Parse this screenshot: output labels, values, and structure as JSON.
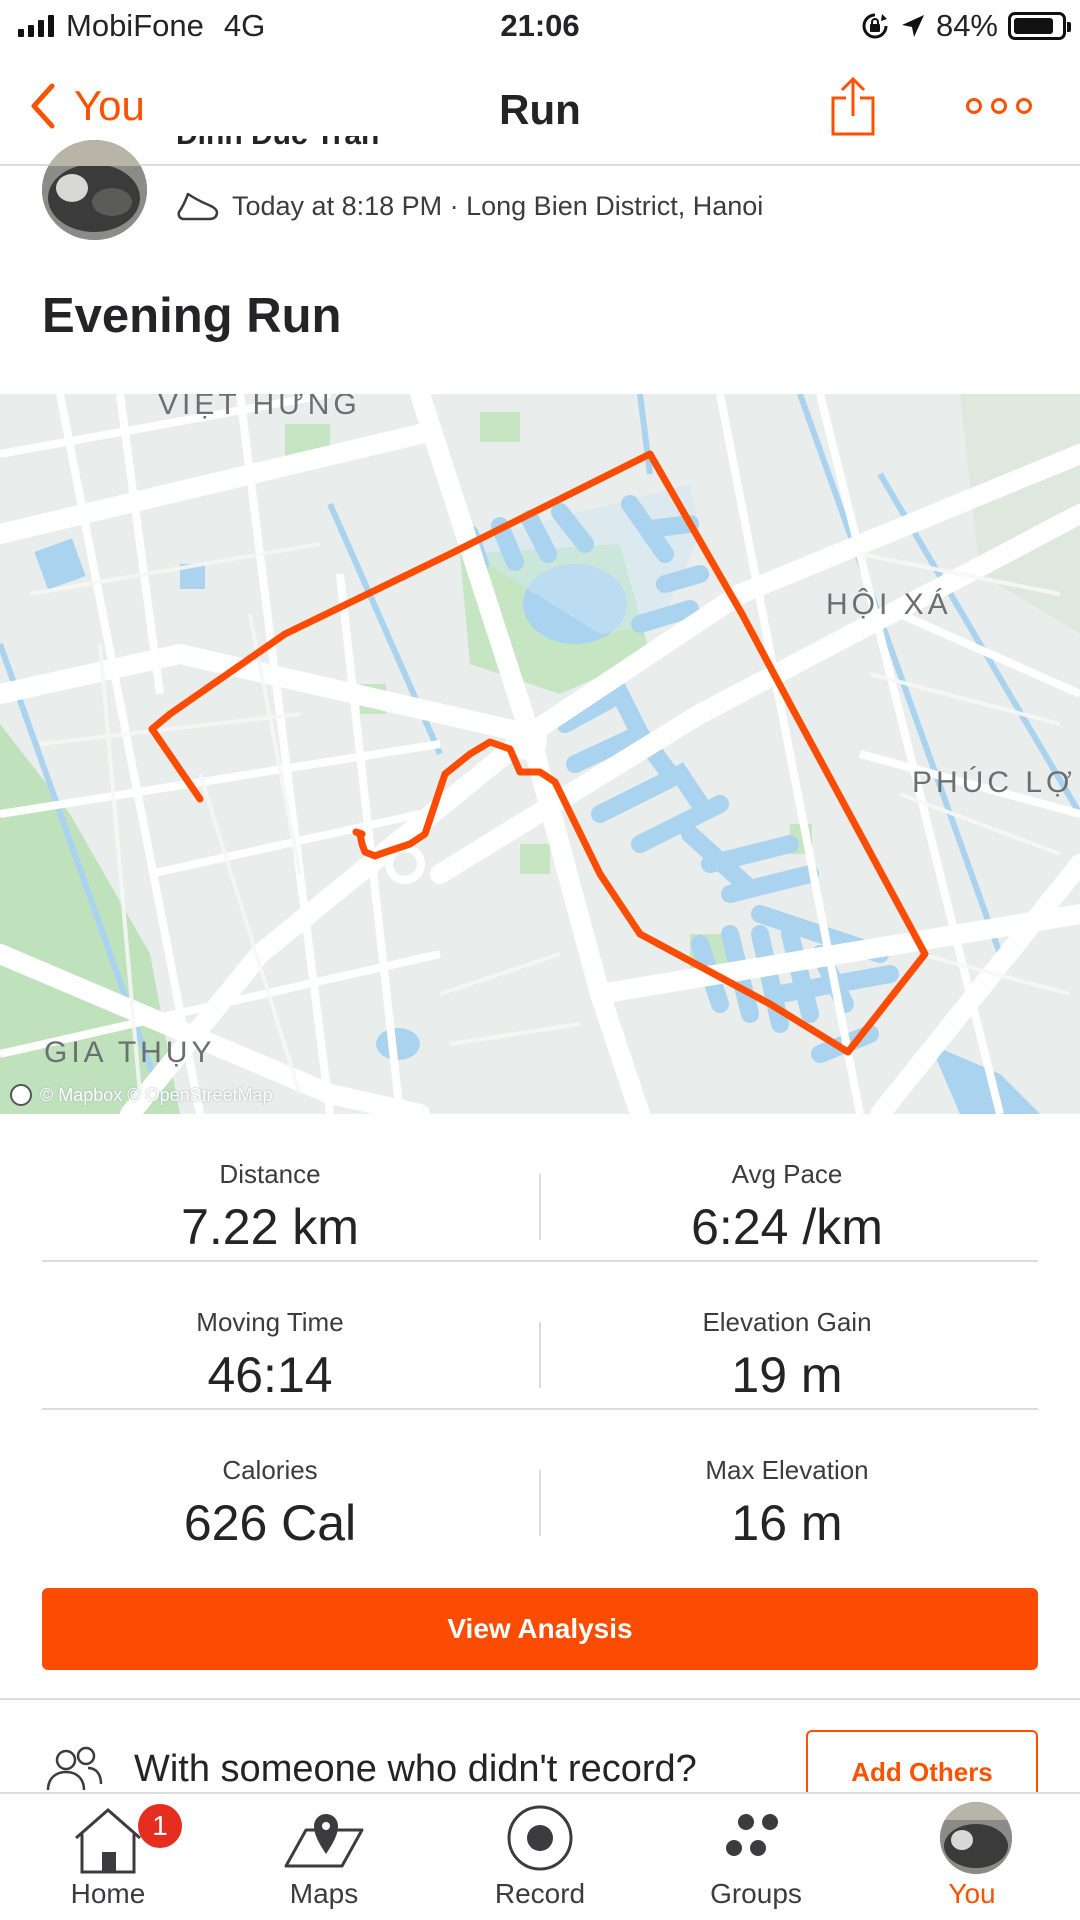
{
  "status_bar": {
    "carrier": "MobiFone",
    "network": "4G",
    "time": "21:06",
    "battery_percent": "84%",
    "battery_level": 0.84
  },
  "nav": {
    "back_label": "You",
    "title": "Run",
    "share_icon": "share-icon",
    "more_icon": "more-icon"
  },
  "activity": {
    "athlete_name": "Dinh Duc Tran",
    "meta": "Today at 8:18 PM · Long Bien District, Hanoi",
    "sport_icon": "shoe-icon",
    "title": "Evening Run"
  },
  "map": {
    "labels": [
      "VIỆT HƯNG",
      "HỘI XÁ",
      "PHÚC LỢ",
      "GIA THỤY"
    ],
    "attribution": "© Mapbox © OpenStreetMap",
    "route_color": "#fc4c02"
  },
  "stats": [
    {
      "label": "Distance",
      "value": "7.22 km"
    },
    {
      "label": "Avg Pace",
      "value": "6:24 /km"
    },
    {
      "label": "Moving Time",
      "value": "46:14"
    },
    {
      "label": "Elevation Gain",
      "value": "19 m"
    },
    {
      "label": "Calories",
      "value": "626 Cal"
    },
    {
      "label": "Max Elevation",
      "value": "16 m"
    }
  ],
  "actions": {
    "view_analysis": "View Analysis",
    "with_prompt": "With someone who didn't record?",
    "add_others": "Add Others"
  },
  "tab_bar": {
    "tabs": [
      {
        "label": "Home",
        "icon": "home-icon",
        "badge": "1"
      },
      {
        "label": "Maps",
        "icon": "map-pin-icon"
      },
      {
        "label": "Record",
        "icon": "record-icon"
      },
      {
        "label": "Groups",
        "icon": "groups-icon"
      },
      {
        "label": "You",
        "icon": "avatar",
        "active": true
      }
    ]
  },
  "colors": {
    "accent": "#fc5200",
    "text": "#242428",
    "divider": "#dcdcde",
    "badge": "#e52e1f"
  }
}
